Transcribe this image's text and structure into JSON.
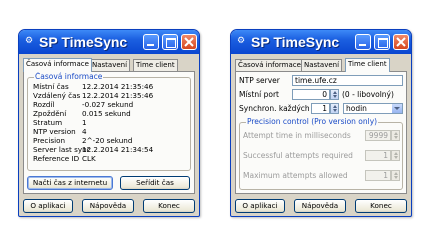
{
  "win1": {
    "title": "SP TimeSync",
    "tabs": [
      "Časová informace",
      "Nastavení",
      "Time client"
    ],
    "group_title": "Časová informace",
    "rows": [
      {
        "key": "Místní čas",
        "value": "12.2.2014 21:35:46"
      },
      {
        "key": "Vzdálený čas",
        "value": "12.2.2014 21:35:46"
      },
      {
        "key": "Rozdíl",
        "value": "-0.027 sekund"
      },
      {
        "key": "Zpoždění",
        "value": "0.015 sekund"
      },
      {
        "key": "Stratum",
        "value": "1"
      },
      {
        "key": "NTP version",
        "value": "4"
      },
      {
        "key": "Precision",
        "value": "2^-20 sekund"
      },
      {
        "key": "Server last sync",
        "value": "12.2.2014 21:34:54"
      },
      {
        "key": "Reference ID",
        "value": "CLK"
      }
    ],
    "fetch_button": "Načti čas z internetu",
    "set_button": "Seřídit čas",
    "about_button": "O aplikaci",
    "help_button": "Nápověda",
    "end_button": "Konec"
  },
  "win2": {
    "title": "SP TimeSync",
    "tabs": [
      "Časová informace",
      "Nastavení",
      "Time client"
    ],
    "ntp_server_label": "NTP server",
    "ntp_server_value": "time.ufe.cz",
    "local_port_label": "Místní port",
    "local_port_value": "0",
    "local_port_hint": "(0 - libovolný)",
    "sync_every_label": "Synchron. každých",
    "sync_every_value": "1",
    "sync_unit": "hodin",
    "precision_group_title": "Precision control (Pro version only)",
    "attempt_time_label": "Attempt time in milliseconds",
    "attempt_time_value": "9999",
    "successful_label": "Successful attempts required",
    "successful_value": "1",
    "maximum_label": "Maximum attempts allowed",
    "maximum_value": "1",
    "about_button": "O aplikaci",
    "help_button": "Nápověda",
    "end_button": "Konec"
  },
  "colors": {
    "titlebar": "#1b5fe0",
    "close": "#d6461e",
    "window_face": "#d9d4c7",
    "group_title": "#1a4bc7"
  },
  "icons": [
    "app-icon",
    "minimize-icon",
    "maximize-icon",
    "close-icon",
    "spin-icon",
    "dropdown-arrow-icon"
  ]
}
